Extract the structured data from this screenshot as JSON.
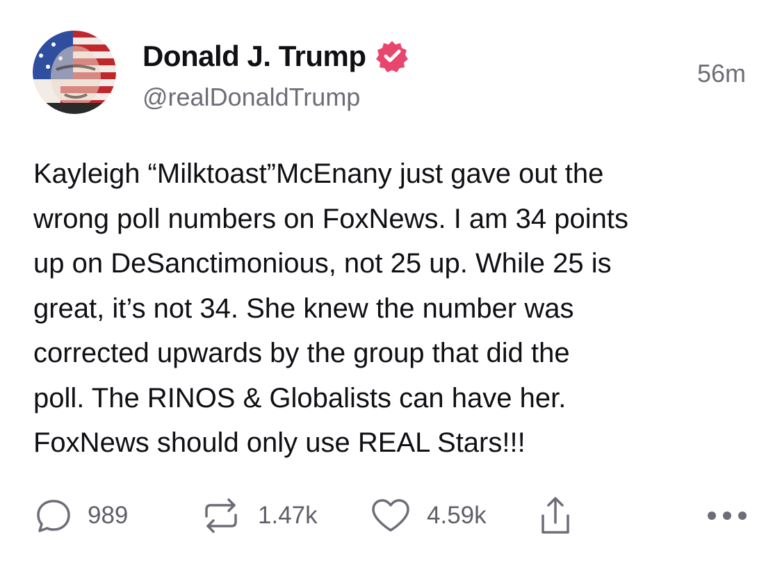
{
  "post": {
    "author": {
      "display_name": "Donald J. Trump",
      "handle": "@realDonaldTrump",
      "verified": true,
      "avatar_icon": "avatar-flag-portrait"
    },
    "timestamp": "56m",
    "text": "Kayleigh “Milktoast”McEnany just gave out the\nwrong poll numbers on FoxNews. I am 34 points\nup on DeSanctimonious, not 25 up. While 25 is\ngreat, it’s not 34. She knew the number was\ncorrected upwards by the group that did the\npoll. The RINOS & Globalists can have her.\nFoxNews should only use REAL Stars!!!",
    "actions": {
      "replies": "989",
      "reposts": "1.47k",
      "likes": "4.59k"
    }
  },
  "colors": {
    "text": "#0f0f14",
    "muted": "#6d6d78",
    "verified_badge": "#e8466c",
    "icon": "#6d6d78"
  },
  "icons": {
    "verified": "verified-badge-icon",
    "reply": "reply-icon",
    "repost": "repost-icon",
    "like": "heart-icon",
    "share": "share-icon",
    "more": "more-icon"
  }
}
